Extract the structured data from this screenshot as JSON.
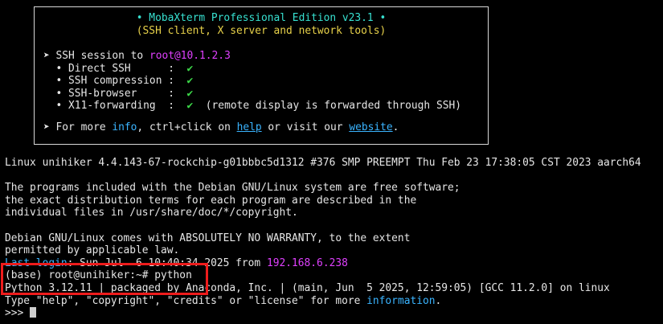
{
  "banner": {
    "title": "• MobaXterm Professional Edition v23.1 •",
    "subtitle": "(SSH client, X server and network tools)",
    "ssh_prefix": "➤ SSH session to ",
    "ssh_target": "root@10.1.2.3",
    "features": [
      {
        "label": "  • Direct SSH      :  ",
        "check": "✔",
        "note": ""
      },
      {
        "label": "  • SSH compression :  ",
        "check": "✔",
        "note": ""
      },
      {
        "label": "  • SSH-browser     :  ",
        "check": "✔",
        "note": ""
      },
      {
        "label": "  • X11-forwarding  :  ",
        "check": "✔",
        "note": "  (remote display is forwarded through SSH)"
      }
    ],
    "more_prefix": "➤ For more ",
    "more_info": "info",
    "more_mid": ", ctrl+click on ",
    "more_help": "help",
    "more_mid2": " or visit our ",
    "more_website": "website",
    "more_end": "."
  },
  "terminal": {
    "kernel_line": "Linux unihiker 4.4.143-67-rockchip-g01bbbc5d1312 #376 SMP PREEMPT Thu Feb 23 17:38:05 CST 2023 aarch64",
    "blank1": "",
    "prog1": "The programs included with the Debian GNU/Linux system are free software;",
    "prog2": "the exact distribution terms for each program are described in the",
    "prog3": "individual files in /usr/share/doc/*/copyright.",
    "blank2": "",
    "warr1": "Debian GNU/Linux comes with ABSOLUTELY NO WARRANTY, to the extent",
    "warr2": "permitted by applicable law.",
    "last_login_label": "Last login",
    "last_login_rest": ": Sun Jul  6 10:40:34 2025 from ",
    "last_login_ip": "192.168.6.238",
    "prompt_line": "(base) root@unihiker:~# python",
    "python_version": "Python 3.12.11 | packaged by Anaconda, Inc. | (main, Jun  5 2025, 12:59:05) [GCC 11.2.0] on linux",
    "type_prefix": "Type \"help\", \"copyright\", \"credits\" or \"license\" for more ",
    "type_info": "information",
    "type_end": ".",
    "repl_prompt": ">>> "
  },
  "colors": {
    "highlight_box": "#ee1c1c",
    "accent_cyan": "#37e0d0",
    "accent_yellow": "#e8d24a",
    "accent_magenta": "#e040ff",
    "accent_blue": "#3ab4ff",
    "check_green": "#3ddc4a"
  }
}
